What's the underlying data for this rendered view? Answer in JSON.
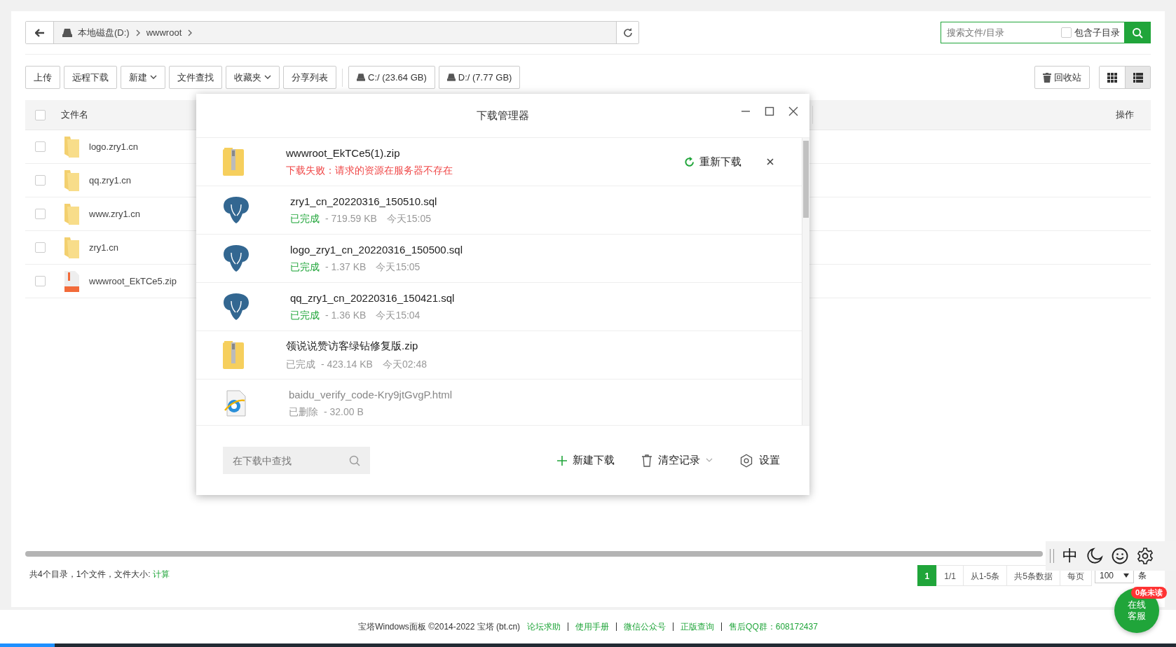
{
  "breadcrumb": {
    "drive": "本地磁盘(D:)",
    "path": [
      "wwwroot"
    ]
  },
  "search": {
    "placeholder": "搜索文件/目录",
    "subdir_label": "包含子目录",
    "subdir_checked": false
  },
  "toolbar": [
    {
      "label": "上传",
      "kind": "plain"
    },
    {
      "label": "远程下载",
      "kind": "plain"
    },
    {
      "label": "新建",
      "kind": "dropdown"
    },
    {
      "label": "文件查找",
      "kind": "plain"
    },
    {
      "label": "收藏夹",
      "kind": "dropdown"
    },
    {
      "label": "分享列表",
      "kind": "plain"
    },
    {
      "label": "C:/ (23.64 GB)",
      "kind": "drive"
    },
    {
      "label": "D:/ (7.77 GB)",
      "kind": "drive"
    }
  ],
  "recycle_label": "回收站",
  "views": [
    {
      "kind": "grid",
      "selected": false
    },
    {
      "kind": "list",
      "selected": true
    }
  ],
  "table": {
    "all_checked": false,
    "columns": [
      "文件名",
      "操作"
    ],
    "rows": [
      {
        "name": "logo.zry1.cn",
        "kind": "folder",
        "checked": false
      },
      {
        "name": "qq.zry1.cn",
        "kind": "folder",
        "checked": false
      },
      {
        "name": "www.zry1.cn",
        "kind": "folder",
        "checked": false
      },
      {
        "name": "zry1.cn",
        "kind": "folder",
        "checked": false
      },
      {
        "name": "wwwroot_EkTCe5.zip",
        "kind": "zip",
        "checked": false
      }
    ]
  },
  "summary": {
    "text": "共4个目录，1个文件，文件大小:",
    "link": "计算"
  },
  "pagination": {
    "pages": [
      {
        "label": "1",
        "selected": true
      }
    ],
    "info": [
      "1/1",
      "从1-5条",
      "共5条数据"
    ],
    "per_page_label": "每页",
    "per_page": "100",
    "unit": "条"
  },
  "footer": {
    "copyright": "宝塔Windows面板 ©2014-2022 宝塔 (bt.cn)",
    "links": [
      "论坛求助",
      "使用手册",
      "微信公众号",
      "正版查询",
      "售后QQ群：608172437"
    ]
  },
  "float_tools": {
    "lang": "中"
  },
  "chat": {
    "lines": [
      "在线",
      "客服"
    ],
    "badge": "0条未读"
  },
  "download_manager": {
    "title": "下载管理器",
    "items": [
      {
        "name": "wwwroot_EkTCe5(1).zip",
        "kind": "zip",
        "failed": true,
        "deleted": false,
        "status_text": "下载失败：请求的资源在服务器不存在",
        "retry_label": "重新下载"
      },
      {
        "name": "zry1_cn_20220316_150510.sql",
        "kind": "sql",
        "failed": false,
        "deleted": false,
        "status_text": "已完成",
        "color": "#20a53a",
        "size": "- 719.59 KB",
        "time": "今天15:05"
      },
      {
        "name": "logo_zry1_cn_20220316_150500.sql",
        "kind": "sql",
        "failed": false,
        "deleted": false,
        "status_text": "已完成",
        "color": "#20a53a",
        "size": "- 1.37 KB",
        "time": "今天15:05"
      },
      {
        "name": "qq_zry1_cn_20220316_150421.sql",
        "kind": "sql",
        "failed": false,
        "deleted": false,
        "status_text": "已完成",
        "color": "#20a53a",
        "size": "- 1.36 KB",
        "time": "今天15:04"
      },
      {
        "name": "领说说赞访客绿钻修复版.zip",
        "kind": "zip",
        "failed": false,
        "deleted": false,
        "status_text": "已完成",
        "color": "#999999",
        "size": "- 423.14 KB",
        "time": "今天02:48"
      },
      {
        "name": "baidu_verify_code-Kry9jtGvgP.html",
        "kind": "html",
        "failed": false,
        "deleted": true,
        "status_text": "已删除",
        "size": "- 32.00 B"
      }
    ],
    "search_placeholder": "在下载中查找",
    "new_label": "新建下载",
    "clear_label": "清空记录",
    "settings_label": "设置"
  }
}
